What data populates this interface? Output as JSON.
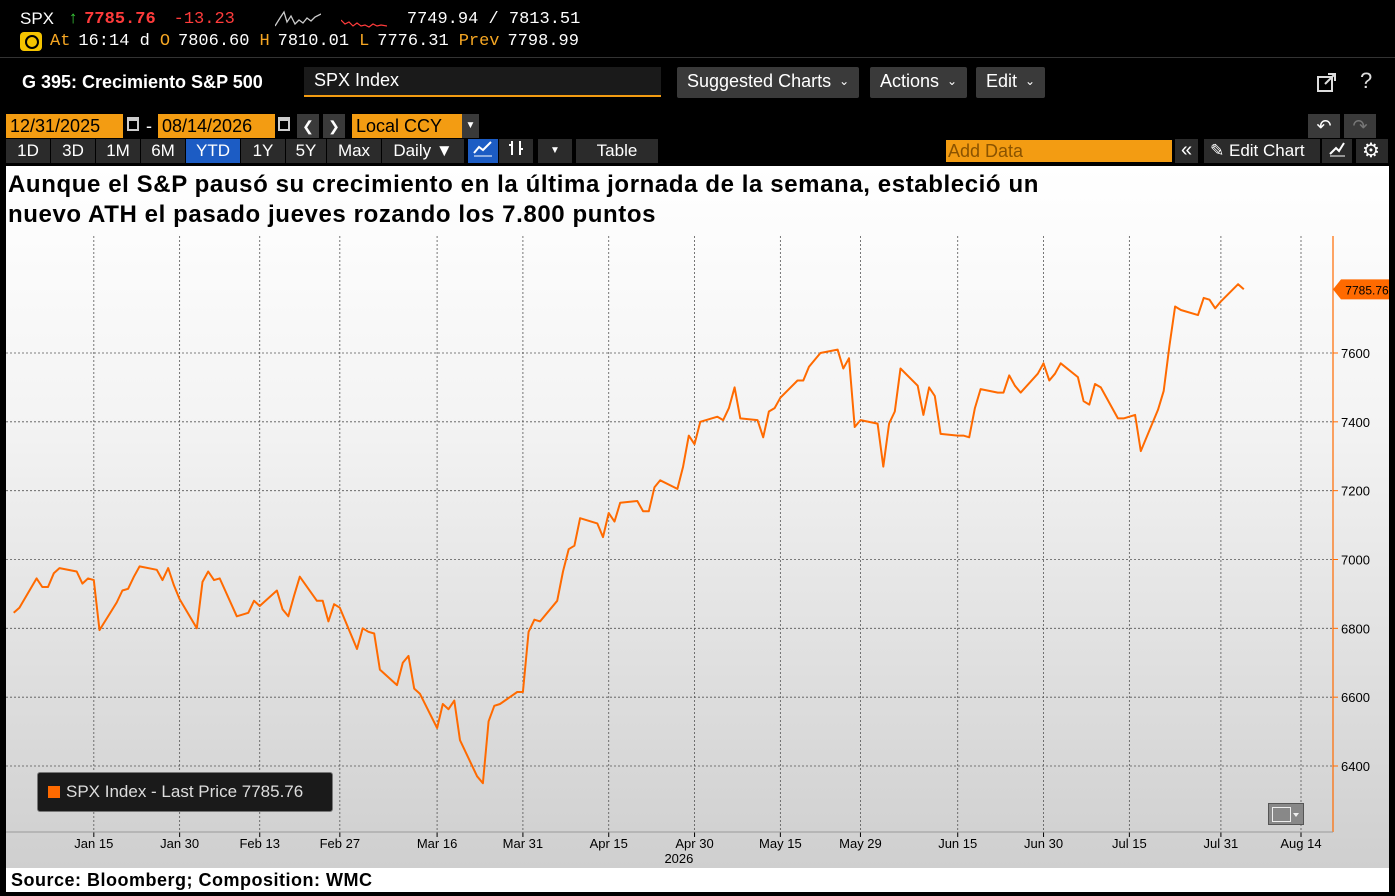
{
  "quote": {
    "ticker": "SPX",
    "last": "7785.76",
    "change": "-13.23",
    "range": "7749.94 / 7813.51",
    "at_label": "At",
    "at_value": "16:14 d",
    "open_label": "O",
    "open_value": "7806.60",
    "high_label": "H",
    "high_value": "7810.01",
    "low_label": "L",
    "low_value": "7776.31",
    "prev_label": "Prev",
    "prev_value": "7798.99"
  },
  "toolbar": {
    "title": "G 395: Crecimiento S&P 500",
    "security": "SPX Index",
    "suggested_charts": "Suggested Charts",
    "actions": "Actions",
    "edit": "Edit"
  },
  "dates": {
    "start": "12/31/2025",
    "end": "08/14/2026",
    "currency": "Local CCY"
  },
  "periods": [
    "1D",
    "3D",
    "1M",
    "6M",
    "YTD",
    "1Y",
    "5Y",
    "Max"
  ],
  "active_period": "YTD",
  "frequency": "Daily",
  "table_label": "Table",
  "add_data_placeholder": "Add Data",
  "edit_chart_label": "Edit Chart",
  "headline": "Aunque el S&P pausó su crecimiento en la última jornada de la semana, estableció un nuevo ATH el pasado jueves rozando los 7.800 puntos",
  "legend_label": "SPX Index - Last Price 7785.76",
  "footer": "Source: Bloomberg; Composition: WMC",
  "colors": {
    "series": "#ff6a00",
    "accent": "#f39c12",
    "up": "#3ad13a",
    "down": "#ff3b3b",
    "active_button": "#1c5cc4"
  },
  "chart_data": {
    "type": "line",
    "title": "Aunque el S&P pausó su crecimiento en la última jornada de la semana, estableció un nuevo ATH el pasado jueves rozando los 7.800 puntos",
    "xlabel": "",
    "ylabel": "",
    "year_label": "2026",
    "x_range": [
      "2025-12-31",
      "2026-08-14"
    ],
    "ylim": [
      6260,
      7900
    ],
    "y_ticks": [
      6400,
      6600,
      6800,
      7000,
      7200,
      7400,
      7600
    ],
    "x_ticks": [
      {
        "date": "2026-01-15",
        "label": "Jan 15"
      },
      {
        "date": "2026-01-30",
        "label": "Jan 30"
      },
      {
        "date": "2026-02-13",
        "label": "Feb 13"
      },
      {
        "date": "2026-02-27",
        "label": "Feb 27"
      },
      {
        "date": "2026-03-16",
        "label": "Mar 16"
      },
      {
        "date": "2026-03-31",
        "label": "Mar 31"
      },
      {
        "date": "2026-04-15",
        "label": "Apr 15"
      },
      {
        "date": "2026-04-30",
        "label": "Apr 30"
      },
      {
        "date": "2026-05-15",
        "label": "May 15"
      },
      {
        "date": "2026-05-29",
        "label": "May 29"
      },
      {
        "date": "2026-06-15",
        "label": "Jun 15"
      },
      {
        "date": "2026-06-30",
        "label": "Jun 30"
      },
      {
        "date": "2026-07-15",
        "label": "Jul 15"
      },
      {
        "date": "2026-07-31",
        "label": "Jul 31"
      },
      {
        "date": "2026-08-14",
        "label": "Aug 14"
      }
    ],
    "grid": true,
    "legend_position": "bottom-left",
    "last_value_label": "7785.76",
    "series": [
      {
        "name": "SPX Index - Last Price",
        "points": [
          [
            "2026-01-01",
            6845
          ],
          [
            "2026-01-02",
            6860
          ],
          [
            "2026-01-05",
            6945
          ],
          [
            "2026-01-06",
            6920
          ],
          [
            "2026-01-07",
            6920
          ],
          [
            "2026-01-08",
            6960
          ],
          [
            "2026-01-09",
            6975
          ],
          [
            "2026-01-12",
            6965
          ],
          [
            "2026-01-13",
            6930
          ],
          [
            "2026-01-14",
            6945
          ],
          [
            "2026-01-15",
            6940
          ],
          [
            "2026-01-16",
            6795
          ],
          [
            "2026-01-19",
            6875
          ],
          [
            "2026-01-20",
            6910
          ],
          [
            "2026-01-21",
            6915
          ],
          [
            "2026-01-22",
            6950
          ],
          [
            "2026-01-23",
            6980
          ],
          [
            "2026-01-26",
            6970
          ],
          [
            "2026-01-27",
            6940
          ],
          [
            "2026-01-28",
            6975
          ],
          [
            "2026-01-29",
            6925
          ],
          [
            "2026-01-30",
            6885
          ],
          [
            "2026-02-02",
            6800
          ],
          [
            "2026-02-03",
            6935
          ],
          [
            "2026-02-04",
            6965
          ],
          [
            "2026-02-05",
            6940
          ],
          [
            "2026-02-06",
            6945
          ],
          [
            "2026-02-09",
            6835
          ],
          [
            "2026-02-10",
            6840
          ],
          [
            "2026-02-11",
            6845
          ],
          [
            "2026-02-12",
            6880
          ],
          [
            "2026-02-13",
            6865
          ],
          [
            "2026-02-16",
            6910
          ],
          [
            "2026-02-17",
            6855
          ],
          [
            "2026-02-18",
            6835
          ],
          [
            "2026-02-19",
            6895
          ],
          [
            "2026-02-20",
            6950
          ],
          [
            "2026-02-23",
            6880
          ],
          [
            "2026-02-24",
            6880
          ],
          [
            "2026-02-25",
            6820
          ],
          [
            "2026-02-26",
            6870
          ],
          [
            "2026-02-27",
            6860
          ],
          [
            "2026-03-02",
            6740
          ],
          [
            "2026-03-03",
            6800
          ],
          [
            "2026-03-04",
            6790
          ],
          [
            "2026-03-05",
            6785
          ],
          [
            "2026-03-06",
            6680
          ],
          [
            "2026-03-09",
            6635
          ],
          [
            "2026-03-10",
            6700
          ],
          [
            "2026-03-11",
            6720
          ],
          [
            "2026-03-12",
            6625
          ],
          [
            "2026-03-13",
            6610
          ],
          [
            "2026-03-16",
            6510
          ],
          [
            "2026-03-17",
            6580
          ],
          [
            "2026-03-18",
            6565
          ],
          [
            "2026-03-19",
            6590
          ],
          [
            "2026-03-20",
            6475
          ],
          [
            "2026-03-23",
            6370
          ],
          [
            "2026-03-24",
            6350
          ],
          [
            "2026-03-25",
            6530
          ],
          [
            "2026-03-26",
            6575
          ],
          [
            "2026-03-27",
            6580
          ],
          [
            "2026-03-30",
            6615
          ],
          [
            "2026-03-31",
            6615
          ],
          [
            "2026-04-01",
            6790
          ],
          [
            "2026-04-02",
            6825
          ],
          [
            "2026-04-03",
            6820
          ],
          [
            "2026-04-06",
            6880
          ],
          [
            "2026-04-07",
            6965
          ],
          [
            "2026-04-08",
            7030
          ],
          [
            "2026-04-09",
            7040
          ],
          [
            "2026-04-10",
            7120
          ],
          [
            "2026-04-13",
            7105
          ],
          [
            "2026-04-14",
            7065
          ],
          [
            "2026-04-15",
            7135
          ],
          [
            "2026-04-16",
            7110
          ],
          [
            "2026-04-17",
            7165
          ],
          [
            "2026-04-20",
            7170
          ],
          [
            "2026-04-21",
            7140
          ],
          [
            "2026-04-22",
            7140
          ],
          [
            "2026-04-23",
            7210
          ],
          [
            "2026-04-24",
            7230
          ],
          [
            "2026-04-27",
            7205
          ],
          [
            "2026-04-28",
            7270
          ],
          [
            "2026-04-29",
            7360
          ],
          [
            "2026-04-30",
            7335
          ],
          [
            "2026-05-01",
            7400
          ],
          [
            "2026-05-04",
            7415
          ],
          [
            "2026-05-05",
            7405
          ],
          [
            "2026-05-06",
            7440
          ],
          [
            "2026-05-07",
            7500
          ],
          [
            "2026-05-08",
            7410
          ],
          [
            "2026-05-11",
            7405
          ],
          [
            "2026-05-12",
            7355
          ],
          [
            "2026-05-13",
            7430
          ],
          [
            "2026-05-14",
            7440
          ],
          [
            "2026-05-15",
            7470
          ],
          [
            "2026-05-18",
            7520
          ],
          [
            "2026-05-19",
            7520
          ],
          [
            "2026-05-20",
            7560
          ],
          [
            "2026-05-21",
            7580
          ],
          [
            "2026-05-22",
            7600
          ],
          [
            "2026-05-25",
            7610
          ],
          [
            "2026-05-26",
            7555
          ],
          [
            "2026-05-27",
            7585
          ],
          [
            "2026-05-28",
            7385
          ],
          [
            "2026-05-29",
            7405
          ],
          [
            "2026-06-01",
            7395
          ],
          [
            "2026-06-02",
            7270
          ],
          [
            "2026-06-03",
            7395
          ],
          [
            "2026-06-04",
            7430
          ],
          [
            "2026-06-05",
            7555
          ],
          [
            "2026-06-08",
            7505
          ],
          [
            "2026-06-09",
            7420
          ],
          [
            "2026-06-10",
            7500
          ],
          [
            "2026-06-11",
            7475
          ],
          [
            "2026-06-12",
            7365
          ],
          [
            "2026-06-15",
            7360
          ],
          [
            "2026-06-16",
            7360
          ],
          [
            "2026-06-17",
            7355
          ],
          [
            "2026-06-18",
            7440
          ],
          [
            "2026-06-19",
            7495
          ],
          [
            "2026-06-22",
            7485
          ],
          [
            "2026-06-23",
            7485
          ],
          [
            "2026-06-24",
            7535
          ],
          [
            "2026-06-25",
            7505
          ],
          [
            "2026-06-26",
            7485
          ],
          [
            "2026-06-29",
            7540
          ],
          [
            "2026-06-30",
            7570
          ],
          [
            "2026-07-01",
            7520
          ],
          [
            "2026-07-02",
            7540
          ],
          [
            "2026-07-03",
            7570
          ],
          [
            "2026-07-06",
            7530
          ],
          [
            "2026-07-07",
            7460
          ],
          [
            "2026-07-08",
            7450
          ],
          [
            "2026-07-09",
            7510
          ],
          [
            "2026-07-10",
            7500
          ],
          [
            "2026-07-13",
            7410
          ],
          [
            "2026-07-14",
            7410
          ],
          [
            "2026-07-15",
            7415
          ],
          [
            "2026-07-16",
            7420
          ],
          [
            "2026-07-17",
            7315
          ],
          [
            "2026-07-20",
            7435
          ],
          [
            "2026-07-21",
            7490
          ],
          [
            "2026-07-22",
            7620
          ],
          [
            "2026-07-23",
            7735
          ],
          [
            "2026-07-24",
            7725
          ],
          [
            "2026-07-27",
            7710
          ],
          [
            "2026-07-28",
            7760
          ],
          [
            "2026-07-29",
            7755
          ],
          [
            "2026-07-30",
            7730
          ],
          [
            "2026-07-31",
            7750
          ],
          [
            "2026-08-03",
            7800
          ],
          [
            "2026-08-04",
            7785
          ]
        ]
      }
    ]
  }
}
